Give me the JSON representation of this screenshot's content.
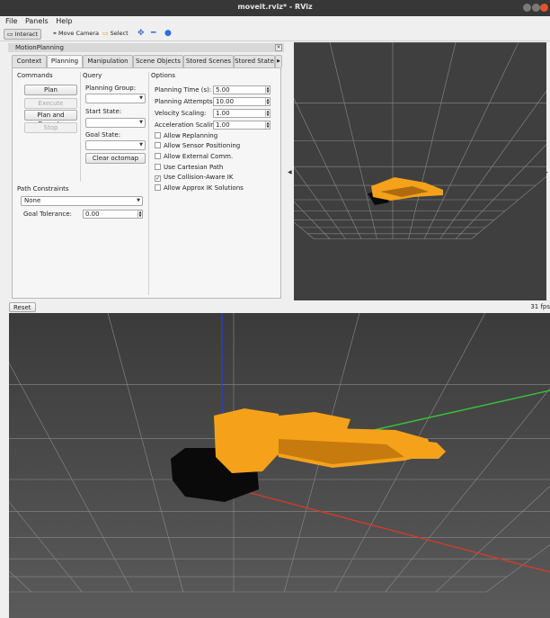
{
  "window": {
    "title": "moveit.rviz* - RViz"
  },
  "menu": {
    "file": "File",
    "panels": "Panels",
    "help": "Help"
  },
  "toolbar": {
    "interact": "Interact",
    "move_camera": "Move Camera",
    "select": "Select"
  },
  "panel": {
    "title": "MotionPlanning"
  },
  "tabs": [
    "Context",
    "Planning",
    "Manipulation",
    "Scene Objects",
    "Stored Scenes",
    "Stored State"
  ],
  "commands": {
    "heading": "Commands",
    "plan": "Plan",
    "execute": "Execute",
    "plan_and_execute": "Plan and Execute",
    "stop": "Stop"
  },
  "query": {
    "heading": "Query",
    "planning_group_label": "Planning Group:",
    "planning_group_value": "",
    "start_state_label": "Start State:",
    "start_state_value": "",
    "goal_state_label": "Goal State:",
    "goal_state_value": "",
    "clear_octomap": "Clear octomap"
  },
  "options": {
    "heading": "Options",
    "planning_time_label": "Planning Time (s):",
    "planning_time_value": "5.00",
    "planning_attempts_label": "Planning Attempts:",
    "planning_attempts_value": "10.00",
    "velocity_scaling_label": "Velocity Scaling:",
    "velocity_scaling_value": "1.00",
    "acceleration_scaling_label": "Acceleration Scaling:",
    "acceleration_scaling_value": "1.00",
    "checks": [
      {
        "label": "Allow Replanning",
        "checked": false
      },
      {
        "label": "Allow Sensor Positioning",
        "checked": false
      },
      {
        "label": "Allow External Comm.",
        "checked": false
      },
      {
        "label": "Use Cartesian Path",
        "checked": false
      },
      {
        "label": "Use Collision-Aware IK",
        "checked": true
      },
      {
        "label": "Allow Approx IK Solutions",
        "checked": false
      }
    ]
  },
  "path_constraints": {
    "heading": "Path Constraints",
    "value": "None",
    "goal_tolerance_label": "Goal Tolerance:",
    "goal_tolerance_value": "0.00"
  },
  "status": {
    "reset": "Reset",
    "fps": "31 fps"
  },
  "colors": {
    "robot": "#f5a21a",
    "base": "#0a0a0a",
    "grid": "#8a8a8a",
    "x_axis": "#d23b2a",
    "y_axis": "#35c43a",
    "z_axis": "#2a3bdc"
  }
}
